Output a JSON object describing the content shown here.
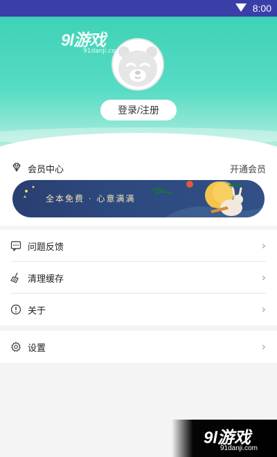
{
  "status_bar": {
    "time": "8:00",
    "icons": [
      "wifi-icon"
    ]
  },
  "header": {
    "watermark": {
      "logo": "9l游戏",
      "domain": "91danji.com"
    },
    "avatar_icon": "bear-face-icon",
    "login_button": "登录/注册"
  },
  "vip": {
    "icon": "diamond-icon",
    "title": "会员中心",
    "action": "开通会员",
    "banner_text": "全本免费 · 心意满满"
  },
  "menu": {
    "items": [
      {
        "icon": "feedback-icon",
        "label": "问题反馈",
        "chevron": "›"
      },
      {
        "icon": "broom-icon",
        "label": "清理缓存",
        "chevron": "›"
      },
      {
        "icon": "info-icon",
        "label": "关于",
        "chevron": "›"
      }
    ]
  },
  "settings": {
    "icon": "gear-icon",
    "label": "设置",
    "chevron": "›"
  },
  "bottom_watermark": {
    "logo": "9l游戏",
    "domain": "91danji.com"
  },
  "colors": {
    "header_start": "#3fd2b6",
    "status_bar": "#3a3fa8",
    "banner": "#2a3f72"
  }
}
